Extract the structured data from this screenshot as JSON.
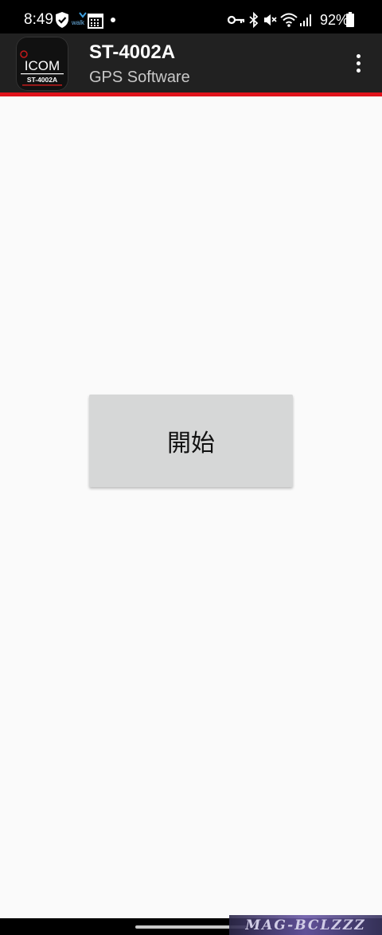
{
  "status_bar": {
    "time": "8:49",
    "walk_label": "walk",
    "battery_percent": "92%"
  },
  "app_bar": {
    "title": "ST-4002A",
    "subtitle": "GPS Software",
    "icon_brand": "ICOM",
    "icon_model": "ST-4002A"
  },
  "main": {
    "start_button_label": "開始"
  },
  "watermark": "MAG-BCLZZZ",
  "colors": {
    "app_bar": "#212121",
    "accent": "#e0131b",
    "button": "#d6d7d7",
    "background": "#fafafa"
  }
}
